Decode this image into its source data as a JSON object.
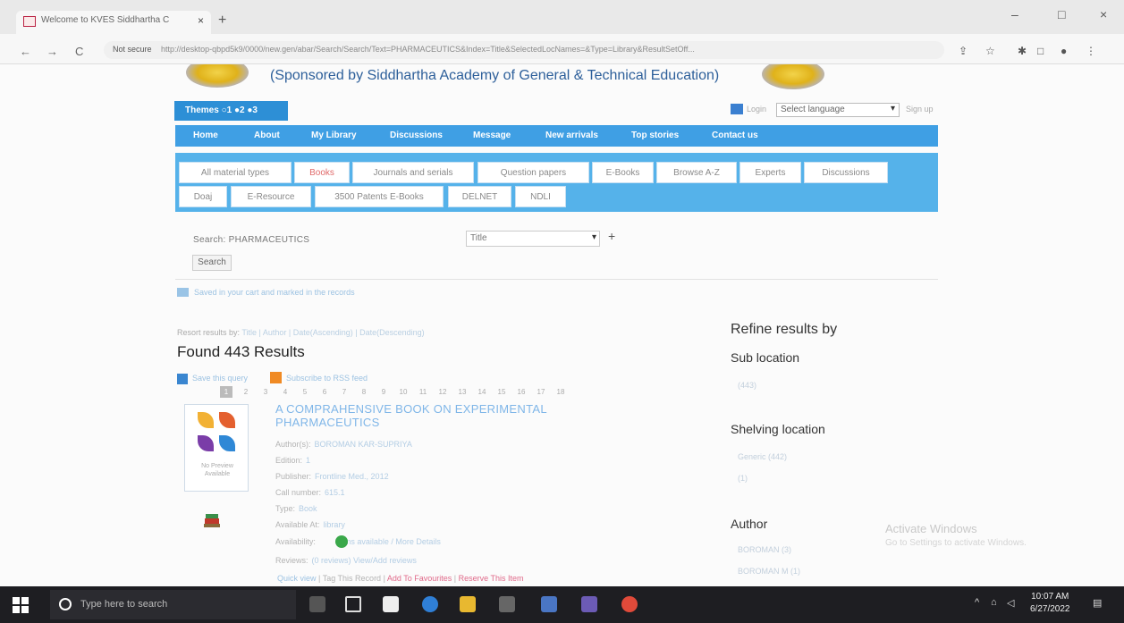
{
  "browser": {
    "tab_title": "Welcome to KVES Siddhartha C",
    "tab_close": "×",
    "new_tab": "+",
    "window_controls": [
      "–",
      "□",
      "×"
    ],
    "nav": {
      "back": "←",
      "forward": "→",
      "reload": "C"
    },
    "security_label": "Not secure",
    "url": "http://desktop-qbpd5k9/0000/new.gen/abar/Search/Search/Text=PHARMACEUTICS&Index=Title&SelectedLocNames=&Type=Library&ResultSetOff...",
    "toolbar_icons": [
      "share-icon",
      "star-icon",
      "extensions-icon",
      "sidebar-icon",
      "profile-icon",
      "menu-icon"
    ]
  },
  "header": {
    "sponsor_text": "(Sponsored by Siddhartha Academy of General & Technical Education)",
    "themes_label": "Themes ○1 ●2 ●3",
    "language_label": "Login",
    "language_select": "Select language",
    "language_extra": "Sign up"
  },
  "main_nav": [
    {
      "label": "Home"
    },
    {
      "label": "About"
    },
    {
      "label": "My Library"
    },
    {
      "label": "Discussions"
    },
    {
      "label": "Message"
    },
    {
      "label": "New arrivals"
    },
    {
      "label": "Top stories"
    },
    {
      "label": "Contact us"
    }
  ],
  "material_tabs_row1": [
    {
      "label": "All material types"
    },
    {
      "label": "Books"
    },
    {
      "label": "Journals and serials"
    },
    {
      "label": "Question papers"
    },
    {
      "label": "E-Books"
    },
    {
      "label": "Browse A-Z"
    },
    {
      "label": "Experts"
    },
    {
      "label": "Discussions"
    }
  ],
  "material_tabs_row2": [
    {
      "label": "Doaj"
    },
    {
      "label": "E-Resource"
    },
    {
      "label": "3500 Patents E-Books"
    },
    {
      "label": "DELNET"
    },
    {
      "label": "NDLI"
    }
  ],
  "search": {
    "label": "Search: PHARMACEUTICS",
    "type": "Title",
    "add": "+",
    "button": "Search",
    "save_link": "Saved in your cart and marked in the records"
  },
  "results": {
    "resort_label": "Resort results by:",
    "resort_options": "Title | Author | Date(Ascending) | Date(Descending)",
    "found": "Found 443 Results",
    "save_query": "Save this query",
    "subscribe": "Subscribe to RSS feed",
    "pages": [
      "1",
      "2",
      "3",
      "4",
      "5",
      "6",
      "7",
      "8",
      "9",
      "10",
      "11",
      "12",
      "13",
      "14",
      "15",
      "16",
      "17",
      "18"
    ],
    "current_page": "1",
    "item": {
      "title": "A COMPRAHENSIVE BOOK ON EXPERIMENTAL PHARMACEUTICS",
      "cover_text": "No Preview Available",
      "meta": [
        {
          "label": "Author(s):",
          "value": "BOROMAN KAR-SUPRIYA"
        },
        {
          "label": "Edition:",
          "value": "1"
        },
        {
          "label": "Publisher:",
          "value": "Frontline Med., 2012"
        },
        {
          "label": "Call number:",
          "value": "615.1"
        },
        {
          "label": "Type:",
          "value": "Book"
        },
        {
          "label": "Available At:",
          "value": "library"
        },
        {
          "label": "Availability:",
          "value": "Items available / More Details"
        },
        {
          "label": "Reviews:",
          "value": "(0 reviews)  View/Add reviews"
        }
      ],
      "actions": {
        "quick_view": "Quick view",
        "tag": "Tag This Record",
        "favourite": "Add To Favourites",
        "reserve": "Reserve This Item"
      }
    }
  },
  "refine": {
    "title": "Refine results by",
    "facets": [
      {
        "heading": "Sub location",
        "items": [
          "(443)"
        ]
      },
      {
        "heading": "Shelving location",
        "items": [
          "Generic (442)",
          "(1)"
        ]
      },
      {
        "heading": "Author",
        "items": [
          "BOROMAN (3)",
          "BOROMAN M (1)"
        ]
      }
    ]
  },
  "watermark": {
    "line1": "Activate Windows",
    "line2": "Go to Settings to activate Windows."
  },
  "taskbar": {
    "search_placeholder": "Type here to search",
    "time": "10:07 AM",
    "date": "6/27/2022"
  },
  "colors": {
    "nav_blue": "#3f9fe4",
    "tab_blue": "#55b2ea",
    "link_blue": "#7fb6e8",
    "taskbar": "#1e1e22"
  }
}
